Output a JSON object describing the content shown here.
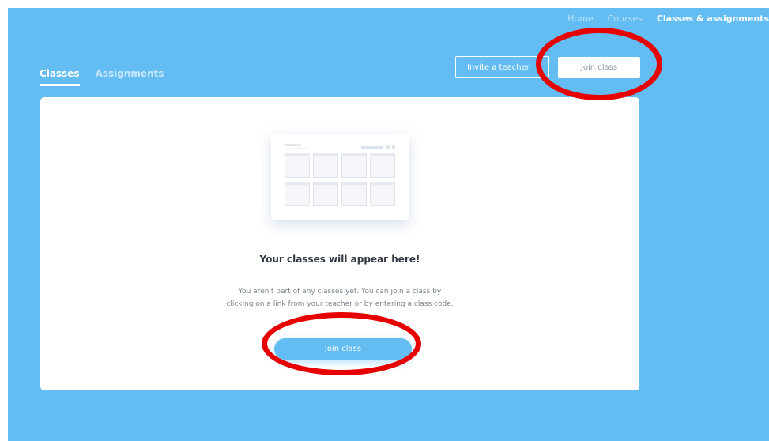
{
  "nav": {
    "home": "Home",
    "courses": "Courses",
    "classes_assignments": "Classes & assignments"
  },
  "tabs": [
    {
      "label": "Classes",
      "active": true
    },
    {
      "label": "Assignments",
      "active": false
    }
  ],
  "actions": {
    "invite_teacher": "Invite a teacher",
    "join_class": "Join class"
  },
  "empty_state": {
    "title": "Your classes will appear here!",
    "line1": "You aren't part of any classes yet. You can join a class by",
    "line2": "clicking on a link from your teacher or by entering a class code.",
    "button": "Join class"
  },
  "colors": {
    "background": "#63bdf2",
    "card": "#ffffff",
    "highlight_ring": "#e60000"
  }
}
